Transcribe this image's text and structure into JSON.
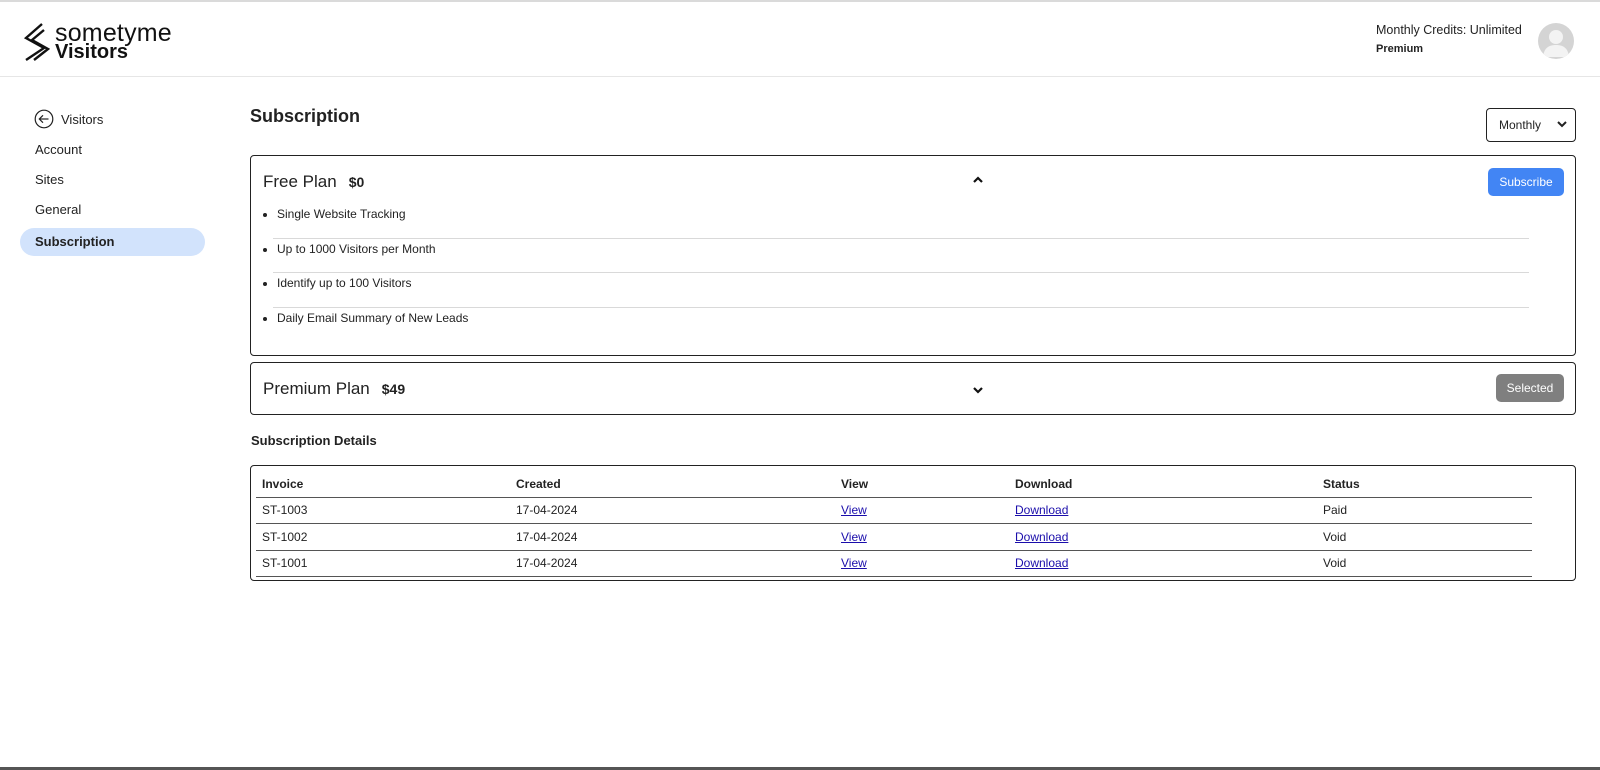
{
  "brand": {
    "line1": "sometyme",
    "line2": "Visitors"
  },
  "account": {
    "credits": "Monthly Credits: Unlimited",
    "tier": "Premium"
  },
  "sidebar": {
    "back_label": "Visitors",
    "items": [
      {
        "label": "Account"
      },
      {
        "label": "Sites"
      },
      {
        "label": "General"
      },
      {
        "label": "Subscription",
        "active": true
      }
    ]
  },
  "page": {
    "title": "Subscription",
    "period": "Monthly"
  },
  "plans": {
    "free": {
      "name": "Free Plan",
      "price": "$0",
      "action": "Subscribe",
      "features": [
        "Single Website Tracking",
        "Up to 1000 Visitors per Month",
        "Identify up to 100 Visitors",
        "Daily Email Summary of New Leads"
      ]
    },
    "premium": {
      "name": "Premium Plan",
      "price": "$49",
      "action": "Selected"
    }
  },
  "details": {
    "title": "Subscription Details",
    "headers": {
      "invoice": "Invoice",
      "created": "Created",
      "view": "View",
      "download": "Download",
      "status": "Status"
    },
    "rows": [
      {
        "invoice": "ST-1003",
        "created": "17-04-2024",
        "view": "View",
        "download": "Download",
        "status": "Paid"
      },
      {
        "invoice": "ST-1002",
        "created": "17-04-2024",
        "view": "View",
        "download": "Download",
        "status": "Void"
      },
      {
        "invoice": "ST-1001",
        "created": "17-04-2024",
        "view": "View",
        "download": "Download",
        "status": "Void"
      }
    ]
  },
  "colors": {
    "accent": "#4285f4",
    "selected": "#7f7f7f",
    "sidebar_active": "#d2e3fc",
    "link": "#1a0dab"
  },
  "icons": {
    "back": "arrow-left-circle-icon",
    "avatar": "user-avatar-icon",
    "expand": "chevron-down-icon",
    "collapse": "chevron-up-icon"
  }
}
